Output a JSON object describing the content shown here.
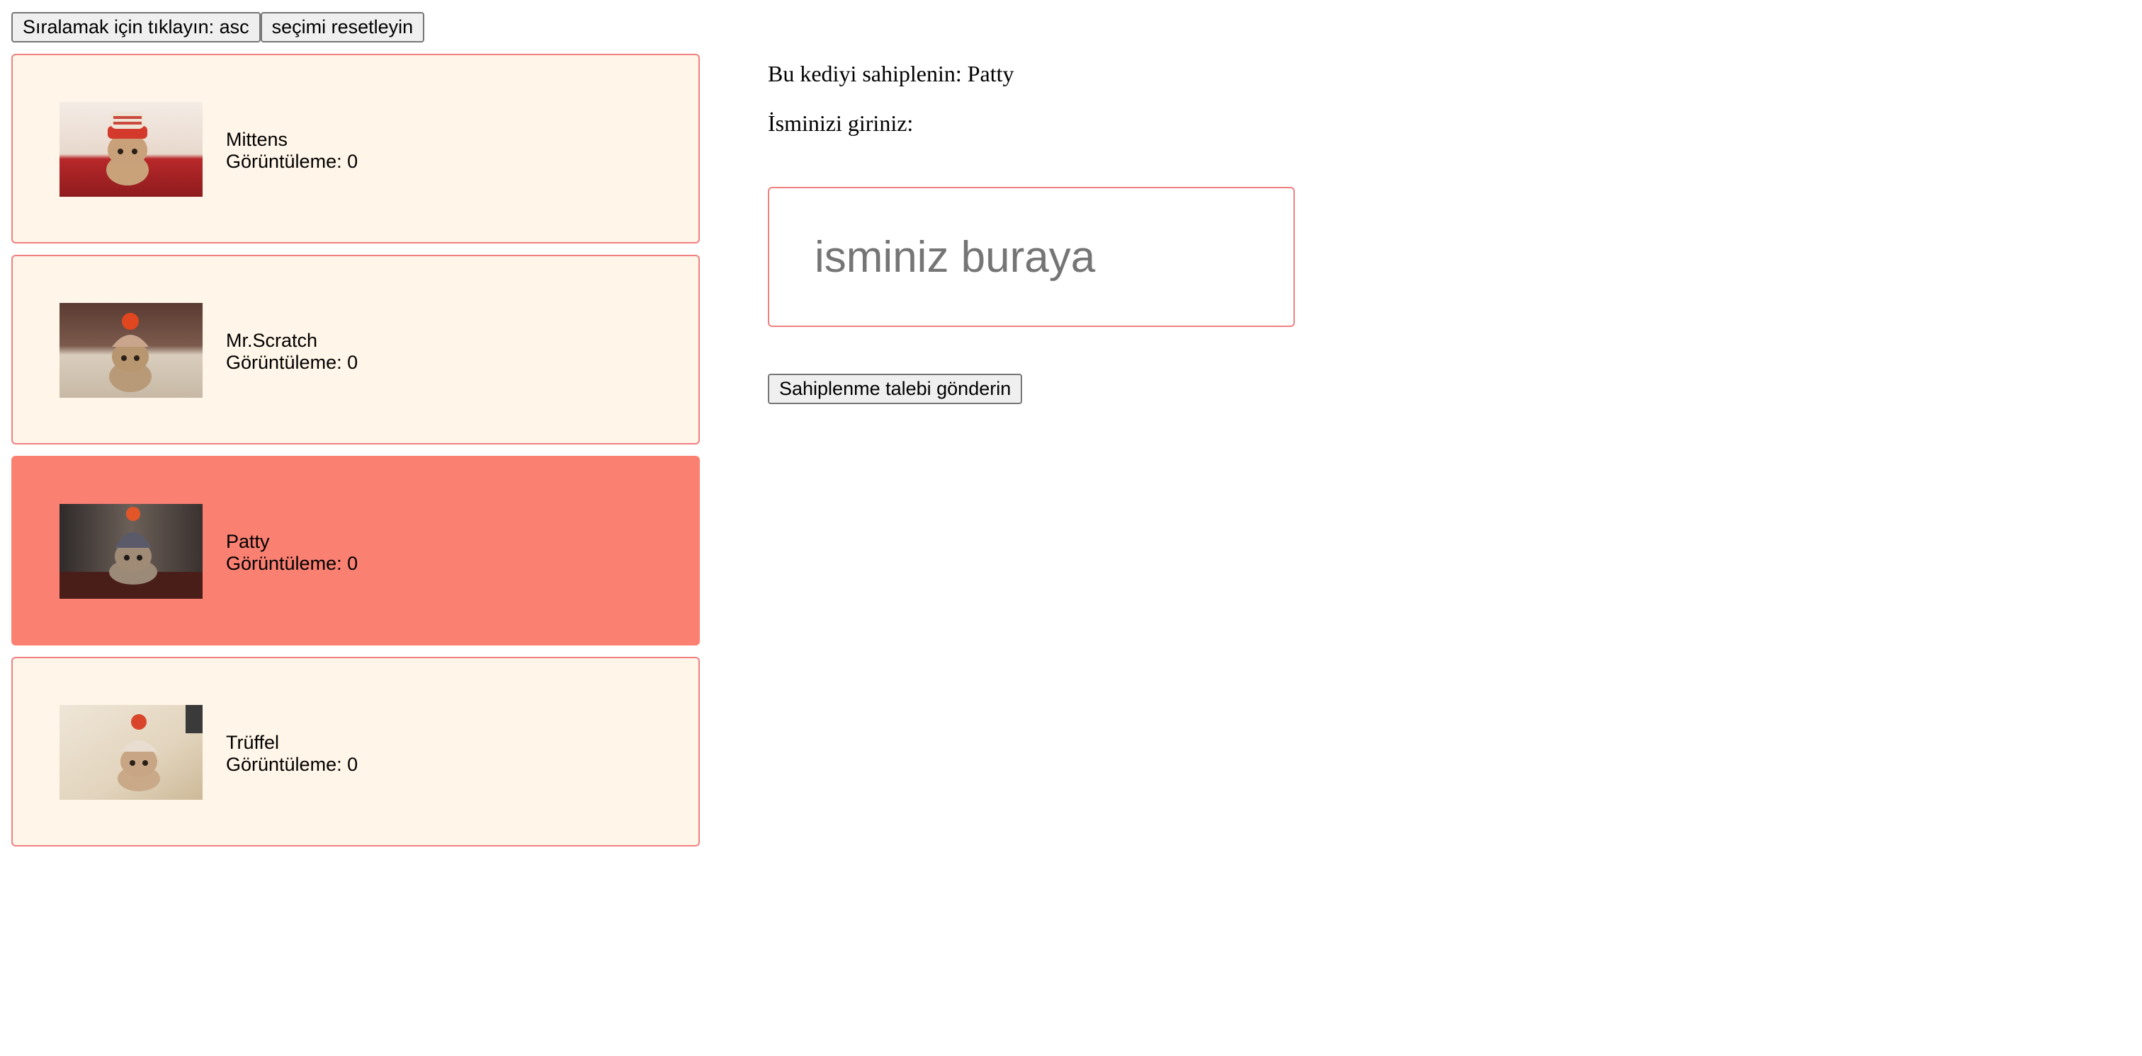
{
  "toolbar": {
    "sort_label": "Sıralamak için tıklayın: asc",
    "reset_label": "seçimi resetleyin"
  },
  "cats": [
    {
      "name": "Mittens",
      "views": "Görüntüleme: 0",
      "selected": false,
      "image": "kitten-red-chef-hat"
    },
    {
      "name": "Mr.Scratch",
      "views": "Görüntüleme: 0",
      "selected": false,
      "image": "kitten-pom-pom-hat-sofa"
    },
    {
      "name": "Patty",
      "views": "Görüntüleme: 0",
      "selected": true,
      "image": "kitten-knit-hat-dark"
    },
    {
      "name": "Trüffel",
      "views": "Görüntüleme: 0",
      "selected": false,
      "image": "kitten-knit-hat-blanket"
    }
  ],
  "adopt": {
    "title": "Bu kediyi sahiplenin: Patty",
    "name_label": "İsminizi giriniz:",
    "name_placeholder": "isminiz buraya",
    "name_value": "",
    "submit_label": "Sahiplenme talebi gönderin"
  },
  "colors": {
    "card_bg": "#fff5e8",
    "card_border": "#f08080",
    "selected_bg": "#fa8072"
  }
}
